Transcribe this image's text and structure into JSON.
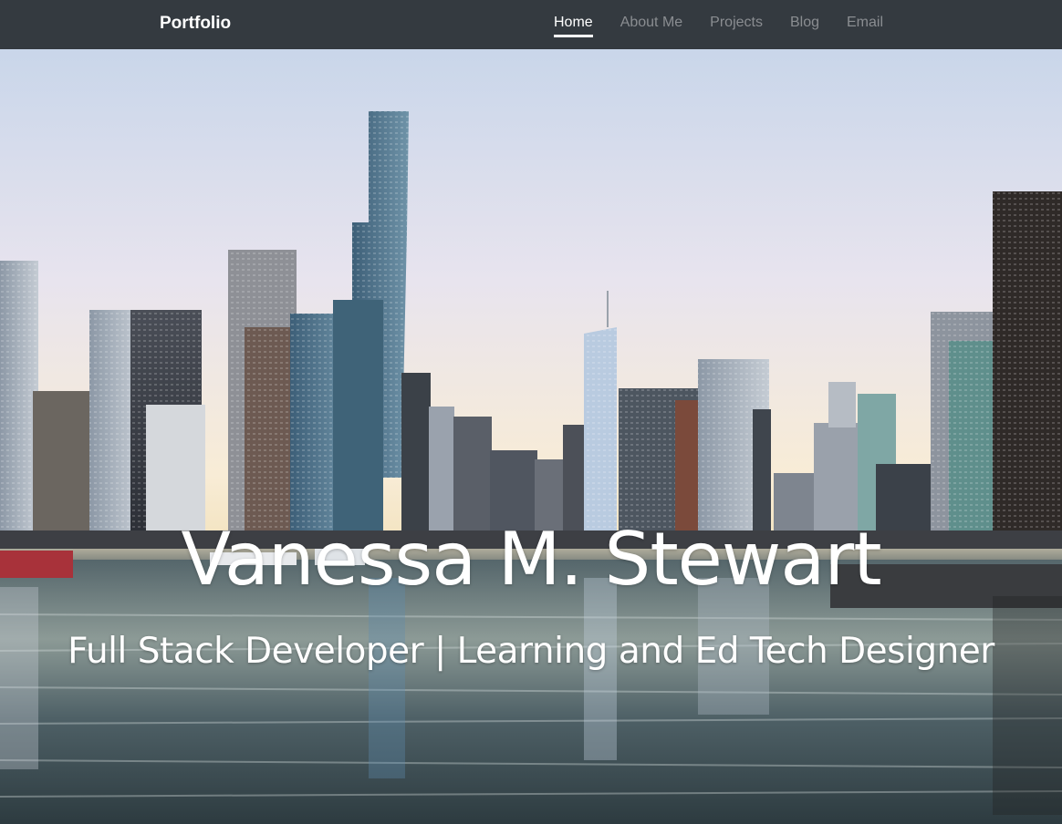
{
  "navbar": {
    "brand": "Portfolio",
    "links": [
      {
        "label": "Home",
        "active": true
      },
      {
        "label": "About Me",
        "active": false
      },
      {
        "label": "Projects",
        "active": false
      },
      {
        "label": "Blog",
        "active": false
      },
      {
        "label": "Email",
        "active": false
      }
    ]
  },
  "hero": {
    "title": "Vanessa M. Stewart",
    "subtitle": "Full Stack Developer | Learning and Ed Tech Designer",
    "background_image": "city-skyline-river-photo"
  },
  "colors": {
    "navbar_bg": "#343a40",
    "nav_active": "#ffffff",
    "nav_inactive": "#8a8d91",
    "hero_text": "#ffffff"
  }
}
